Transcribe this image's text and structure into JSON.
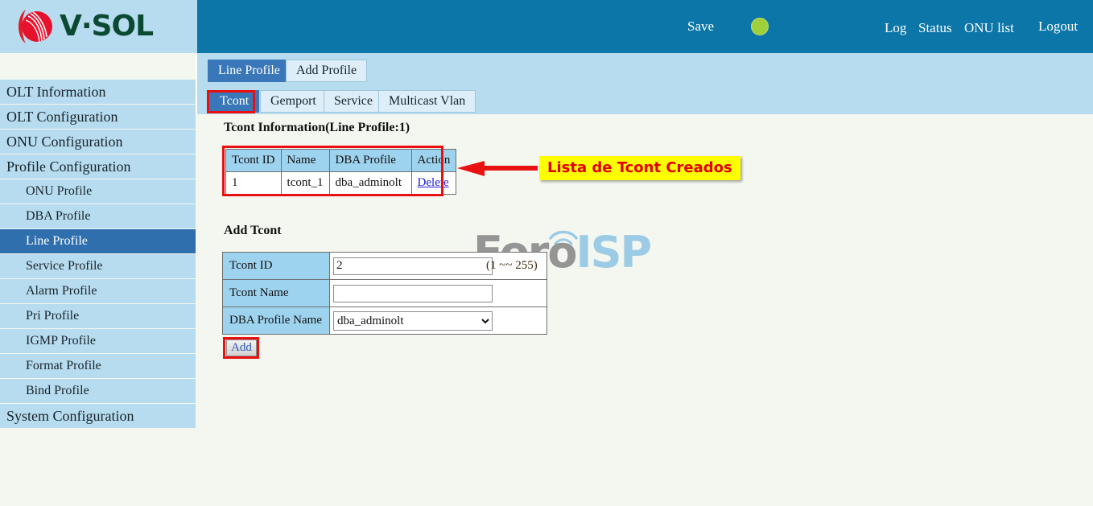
{
  "brand": {
    "logo_icon": "vsol-swirl-logo-icon",
    "name": "V·SOL"
  },
  "header": {
    "save_label": "Save",
    "status_led": "status-led-green",
    "led_color": "#9fd03c",
    "links": {
      "log": "Log",
      "status": "Status",
      "onu_list": "ONU list",
      "logout": "Logout"
    }
  },
  "sidebar": {
    "items": [
      {
        "label": "OLT Information",
        "level": "top",
        "active": false
      },
      {
        "label": "OLT Configuration",
        "level": "top",
        "active": false
      },
      {
        "label": "ONU Configuration",
        "level": "top",
        "active": false
      },
      {
        "label": "Profile Configuration",
        "level": "top",
        "active": false
      },
      {
        "label": "ONU Profile",
        "level": "sub",
        "active": false
      },
      {
        "label": "DBA Profile",
        "level": "sub",
        "active": false
      },
      {
        "label": "Line Profile",
        "level": "sub",
        "active": true
      },
      {
        "label": "Service Profile",
        "level": "sub",
        "active": false
      },
      {
        "label": "Alarm Profile",
        "level": "sub",
        "active": false
      },
      {
        "label": "Pri Profile",
        "level": "sub",
        "active": false
      },
      {
        "label": "IGMP Profile",
        "level": "sub",
        "active": false
      },
      {
        "label": "Format Profile",
        "level": "sub",
        "active": false
      },
      {
        "label": "Bind Profile",
        "level": "sub",
        "active": false
      },
      {
        "label": "System Configuration",
        "level": "top",
        "active": false
      }
    ]
  },
  "tabs_primary": [
    {
      "label": "Line Profile",
      "active": true
    },
    {
      "label": "Add Profile",
      "active": false
    }
  ],
  "tabs_secondary": [
    {
      "label": "Tcont",
      "active": true
    },
    {
      "label": "Gemport",
      "active": false
    },
    {
      "label": "Service",
      "active": false
    },
    {
      "label": "Multicast Vlan",
      "active": false
    }
  ],
  "main": {
    "info_title": "Tcont Information(Line Profile:1)",
    "table": {
      "headers": [
        "Tcont ID",
        "Name",
        "DBA Profile",
        "Action"
      ],
      "rows": [
        {
          "id": "1",
          "name": "tcont_1",
          "dba": "dba_adminolt",
          "action": "Delete"
        }
      ]
    },
    "add_title": "Add Tcont",
    "form": {
      "tcont_id_label": "Tcont ID",
      "tcont_id_value": "2",
      "tcont_id_hint": "(1 ~~ 255)",
      "tcont_name_label": "Tcont Name",
      "tcont_name_value": "",
      "tcont_name_placeholder": "",
      "dba_label": "DBA Profile Name",
      "dba_selected": "dba_adminolt",
      "dba_options": [
        "dba_adminolt"
      ]
    },
    "add_button_label": "Add"
  },
  "annotation": {
    "text": "Lista de Tcont Creados",
    "box_color": "#ffff00",
    "text_color": "#e00000",
    "arrow_color": "#e81010",
    "highlight_color": "#e81010"
  },
  "watermark": {
    "part1": "Foro",
    "part2": "ISP"
  }
}
